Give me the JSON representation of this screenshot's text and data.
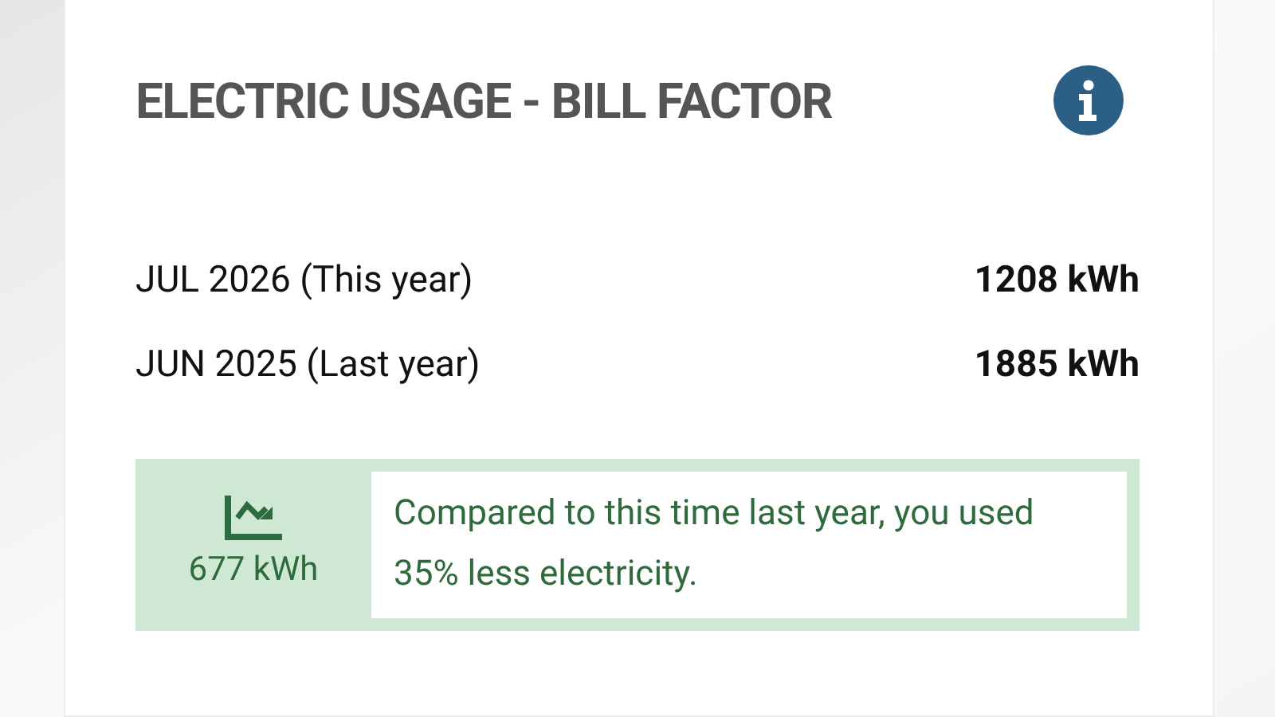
{
  "card": {
    "title": "ELECTRIC USAGE - BILL FACTOR",
    "rows": [
      {
        "label": "JUL 2026 (This year)",
        "value": "1208 kWh"
      },
      {
        "label": "JUN 2025 (Last year)",
        "value": "1885 kWh"
      }
    ],
    "comparison": {
      "difference": "677 kWh",
      "message": "Compared to this time last year, you used 35% less electricity."
    }
  }
}
